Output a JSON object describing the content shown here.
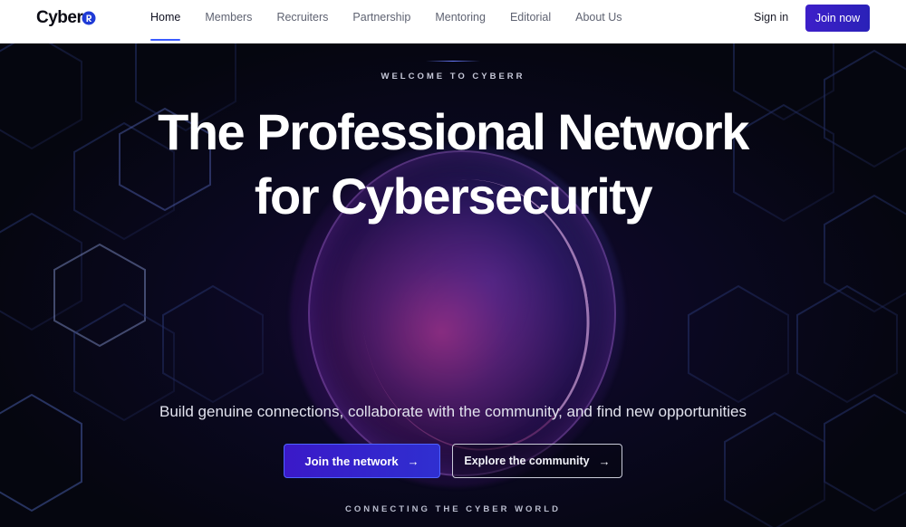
{
  "brand": {
    "logo_text": "Cyber",
    "logo_mark": "R",
    "accent": "#3b5bff"
  },
  "nav": {
    "items": [
      {
        "label": "Home",
        "active": true
      },
      {
        "label": "Members",
        "active": false
      },
      {
        "label": "Recruiters",
        "active": false
      },
      {
        "label": "Partnership",
        "active": false
      },
      {
        "label": "Mentoring",
        "active": false
      },
      {
        "label": "Editorial",
        "active": false
      },
      {
        "label": "About Us",
        "active": false
      }
    ],
    "signin_label": "Sign in",
    "join_label": "Join now"
  },
  "hero": {
    "eyebrow": "WELCOME TO CYBERR",
    "title_line1": "The Professional Network",
    "title_line2": "for Cybersecurity",
    "subtitle": "Build genuine connections, collaborate with the community, and find new opportunities",
    "primary_cta": "Join the network",
    "secondary_cta": "Explore the community",
    "arrow_icon": "arrow-right-icon",
    "footer_tag": "CONNECTING THE CYBER WORLD"
  }
}
